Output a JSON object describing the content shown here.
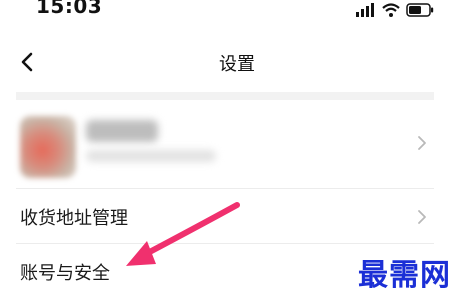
{
  "status_bar": {
    "time": "15:03"
  },
  "nav": {
    "title": "设置"
  },
  "menu": [
    {
      "label": "收货地址管理"
    },
    {
      "label": "账号与安全"
    }
  ],
  "watermark": "最需网",
  "colors": {
    "arrow": "#f0306e",
    "watermark": "#1b2fd6",
    "chevron": "#b9b9b9"
  }
}
